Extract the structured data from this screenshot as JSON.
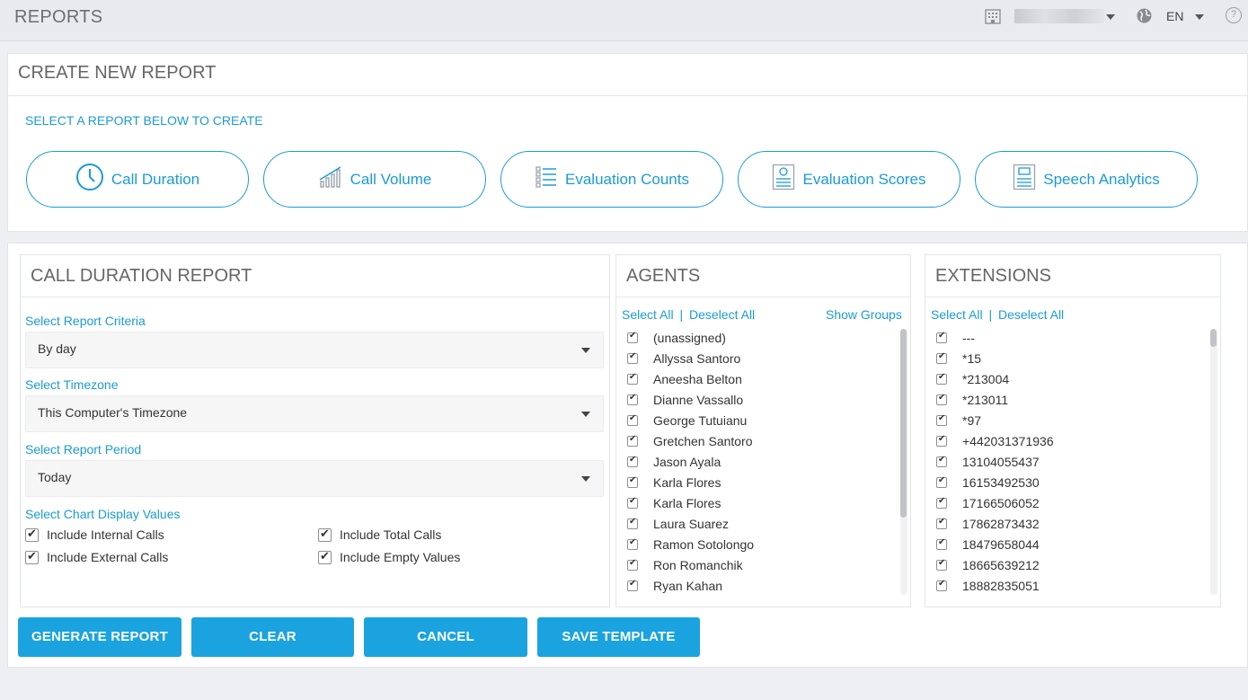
{
  "topbar": {
    "title": "REPORTS",
    "language": "EN",
    "help_symbol": "?"
  },
  "create": {
    "heading": "CREATE NEW REPORT",
    "subheading": "SELECT A REPORT BELOW TO CREATE",
    "types": [
      {
        "label": "Call Duration",
        "icon": "clock-icon"
      },
      {
        "label": "Call Volume",
        "icon": "bar-chart-icon"
      },
      {
        "label": "Evaluation Counts",
        "icon": "list-icon"
      },
      {
        "label": "Evaluation Scores",
        "icon": "score-sheet-icon"
      },
      {
        "label": "Speech Analytics",
        "icon": "transcript-icon"
      }
    ]
  },
  "report": {
    "heading": "CALL DURATION REPORT",
    "criteria_label": "Select Report Criteria",
    "criteria_value": "By day",
    "timezone_label": "Select Timezone",
    "timezone_value": "This Computer's Timezone",
    "period_label": "Select Report Period",
    "period_value": "Today",
    "chart_label": "Select Chart Display Values",
    "options": [
      {
        "label": "Include Internal Calls",
        "checked": true
      },
      {
        "label": "Include Total Calls",
        "checked": true
      },
      {
        "label": "Include External Calls",
        "checked": true
      },
      {
        "label": "Include Empty Values",
        "checked": true
      }
    ]
  },
  "agents": {
    "heading": "AGENTS",
    "select_all": "Select All",
    "separator": "|",
    "deselect_all": "Deselect All",
    "show_groups": "Show Groups",
    "items": [
      "(unassigned)",
      "Allyssa Santoro",
      "Aneesha Belton",
      "Dianne Vassallo",
      "George Tutuianu",
      "Gretchen Santoro",
      "Jason Ayala",
      "Karla Flores",
      "Karla Flores",
      "Laura Suarez",
      "Ramon Sotolongo",
      "Ron Romanchik",
      "Ryan Kahan"
    ]
  },
  "extensions": {
    "heading": "EXTENSIONS",
    "select_all": "Select All",
    "separator": "|",
    "deselect_all": "Deselect All",
    "items": [
      "---",
      "*15",
      "*213004",
      "*213011",
      "*97",
      "+442031371936",
      "13104055437",
      "16153492530",
      "17166506052",
      "17862873432",
      "18479658044",
      "18665639212",
      "18882835051"
    ]
  },
  "actions": {
    "generate": "GENERATE REPORT",
    "clear": "CLEAR",
    "cancel": "CANCEL",
    "save_template": "SAVE TEMPLATE"
  },
  "colors": {
    "accent": "#1a9bd7",
    "button": "#1ba3df",
    "background": "#eeeff3"
  }
}
